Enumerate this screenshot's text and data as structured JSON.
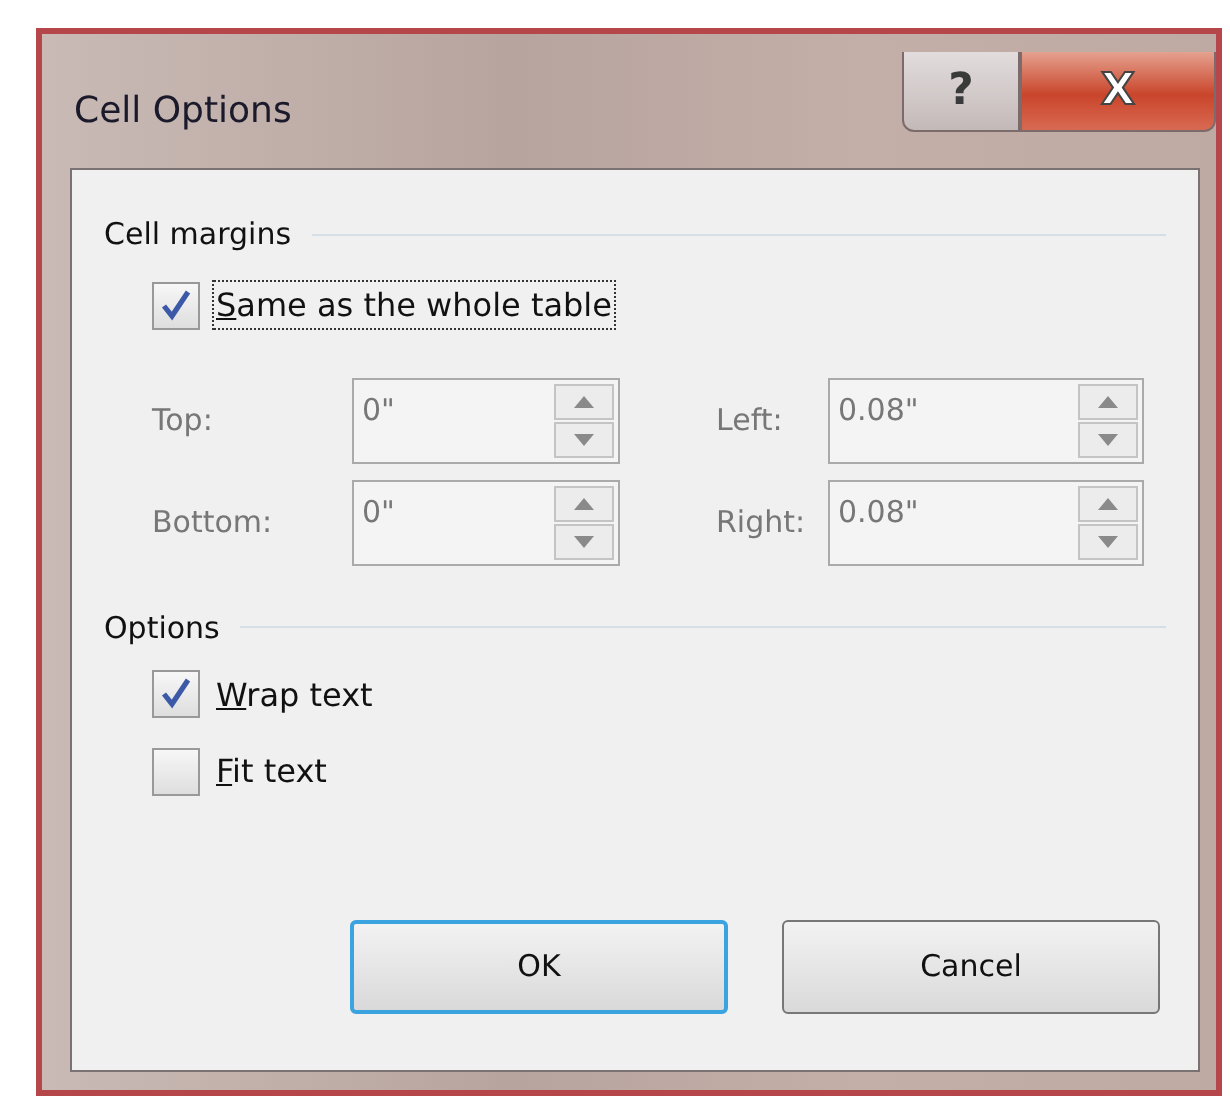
{
  "window": {
    "title": "Cell Options",
    "title_buttons": [
      {
        "kind": "help",
        "label": "?"
      },
      {
        "kind": "close",
        "label": "X"
      }
    ]
  },
  "cell_margins": {
    "heading": "Cell margins",
    "checkbox": {
      "label": "Same as the whole table",
      "underline_first_letter": true,
      "checked": true,
      "focused": true
    },
    "fields": [
      {
        "label": "Top:",
        "value": "0\"",
        "disabled": true
      },
      {
        "label": "Left:",
        "value": "0.08\"",
        "disabled": true
      },
      {
        "label": "Bottom:",
        "value": "0\"",
        "disabled": true
      },
      {
        "label": "Right:",
        "value": "0.08\"",
        "disabled": true
      }
    ]
  },
  "options": {
    "heading": "Options",
    "checkboxes": [
      {
        "label": "Wrap text",
        "underline_first_letter": true,
        "checked": true
      },
      {
        "label": "Fit text",
        "underline_first_letter": true,
        "checked": false
      }
    ]
  },
  "buttons": [
    {
      "label": "OK",
      "default": true
    },
    {
      "label": "Cancel",
      "default": false
    }
  ]
}
